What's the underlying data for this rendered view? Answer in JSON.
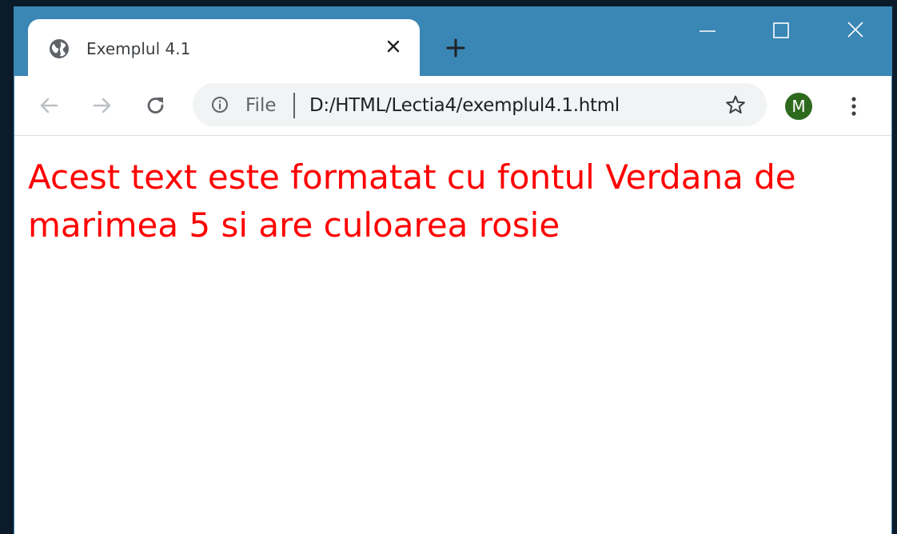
{
  "browser": {
    "tab": {
      "title": "Exemplul 4.1",
      "favicon": "globe-icon"
    },
    "toolbar": {
      "back_icon": "arrow-left-icon",
      "forward_icon": "arrow-right-icon",
      "reload_icon": "reload-icon",
      "address": {
        "scheme_label": "File",
        "url": "D:/HTML/Lectia4/exemplul4.1.html",
        "info_icon": "info-icon",
        "bookmark_icon": "star-icon"
      },
      "profile_initial": "M",
      "menu_icon": "kebab-menu-icon"
    },
    "colors": {
      "titlebar": "#3a86b4",
      "avatar": "#2d6a1e",
      "page_text": "#ff0000"
    }
  },
  "page": {
    "text": "Acest text este formatat cu fontul Verdana de marimea 5 si are culoarea rosie"
  }
}
